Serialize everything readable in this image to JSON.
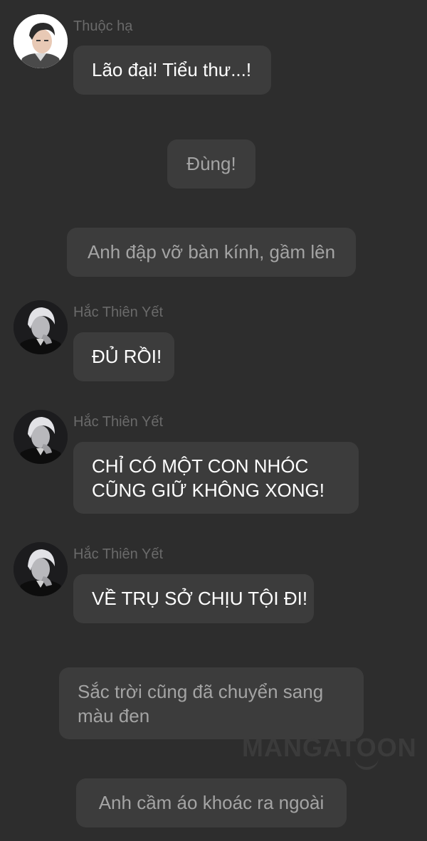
{
  "colors": {
    "background": "#2d2d2d",
    "bubble": "#3c3c3c",
    "speech_text": "#ffffff",
    "narration_text": "#a4a4a4",
    "speaker_name": "#6a6a6a"
  },
  "messages": [
    {
      "type": "speech",
      "speaker": "Thuộc hạ",
      "avatar": "subordinate-avatar",
      "lines": [
        "Lão đại! Tiểu thư...!"
      ]
    },
    {
      "type": "narration",
      "lines": [
        "Đùng!"
      ]
    },
    {
      "type": "narration",
      "lines": [
        "Anh đập vỡ bàn kính, gầm lên"
      ]
    },
    {
      "type": "speech",
      "speaker": "Hắc Thiên Yết",
      "avatar": "hac-thien-yet-avatar",
      "lines": [
        "ĐỦ RỒI!"
      ]
    },
    {
      "type": "speech",
      "speaker": "Hắc Thiên Yết",
      "avatar": "hac-thien-yet-avatar",
      "lines": [
        "CHỈ CÓ MỘT CON NHÓC",
        "CŨNG GIỮ KHÔNG XONG!"
      ]
    },
    {
      "type": "speech",
      "speaker": "Hắc Thiên Yết",
      "avatar": "hac-thien-yet-avatar",
      "lines": [
        "VỀ TRỤ SỞ CHỊU TỘI ĐI!"
      ]
    },
    {
      "type": "narration",
      "lines": [
        "Sắc trời cũng đã chuyển sang",
        "màu đen"
      ]
    },
    {
      "type": "narration",
      "lines": [
        "Anh cầm áo khoác ra ngoài"
      ]
    }
  ],
  "watermark": "MANGATOON"
}
